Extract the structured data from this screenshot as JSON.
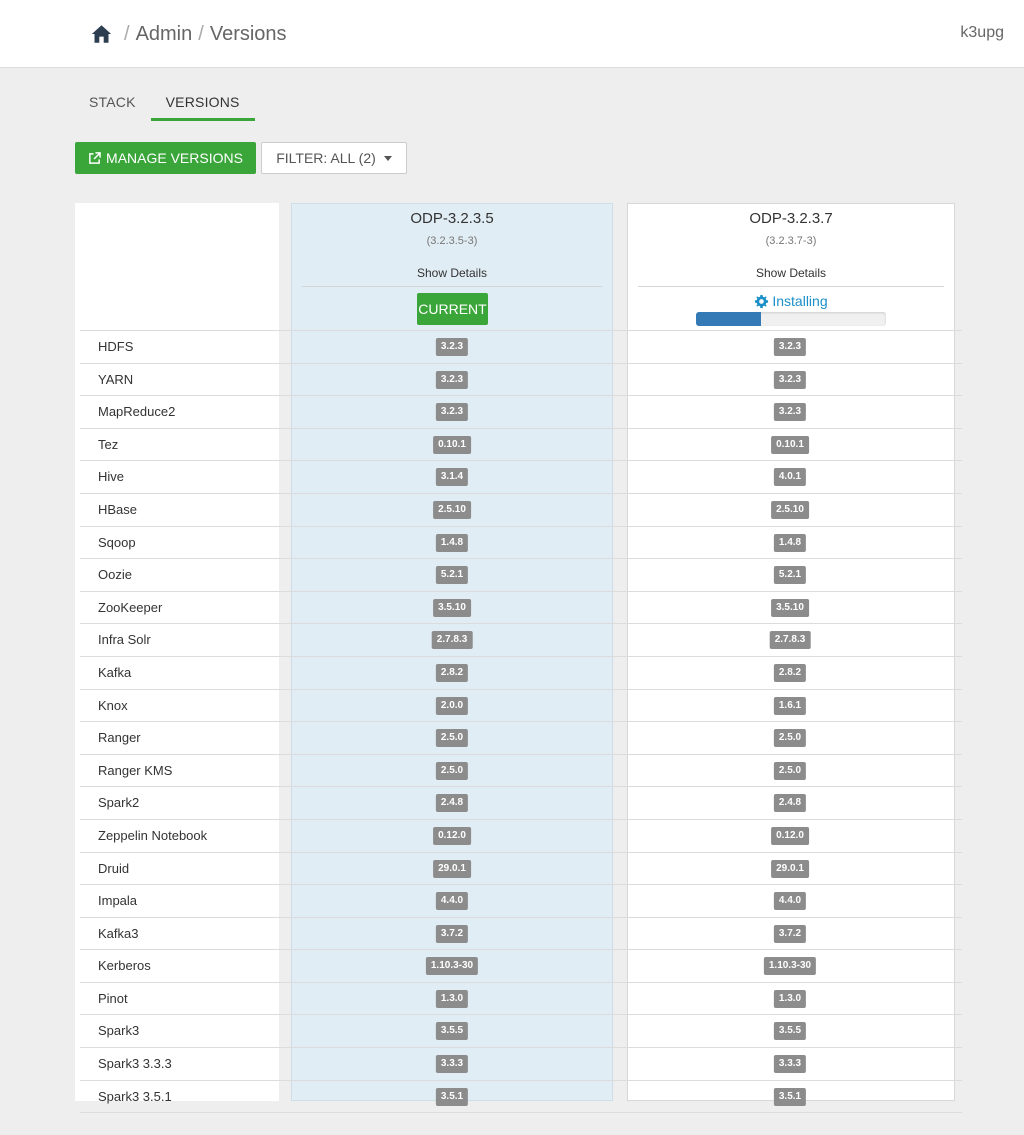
{
  "breadcrumb": {
    "items": [
      "Admin",
      "Versions"
    ],
    "separator": "/"
  },
  "user": {
    "name": "k3upg"
  },
  "tabs": [
    {
      "label": "STACK",
      "active": false
    },
    {
      "label": "VERSIONS",
      "active": true
    }
  ],
  "toolbar": {
    "manage_label": "MANAGE VERSIONS",
    "filter_label": "FILTER: ALL (2)"
  },
  "versions": [
    {
      "name": "ODP-3.2.3.5",
      "build": "(3.2.3.5-3)",
      "show_details": "Show Details",
      "status": "CURRENT"
    },
    {
      "name": "ODP-3.2.3.7",
      "build": "(3.2.3.7-3)",
      "show_details": "Show Details",
      "status": "Installing",
      "progress": 0.34
    }
  ],
  "services": [
    {
      "name": "HDFS",
      "v1": "3.2.3",
      "v2": "3.2.3"
    },
    {
      "name": "YARN",
      "v1": "3.2.3",
      "v2": "3.2.3"
    },
    {
      "name": "MapReduce2",
      "v1": "3.2.3",
      "v2": "3.2.3"
    },
    {
      "name": "Tez",
      "v1": "0.10.1",
      "v2": "0.10.1"
    },
    {
      "name": "Hive",
      "v1": "3.1.4",
      "v2": "4.0.1"
    },
    {
      "name": "HBase",
      "v1": "2.5.10",
      "v2": "2.5.10"
    },
    {
      "name": "Sqoop",
      "v1": "1.4.8",
      "v2": "1.4.8"
    },
    {
      "name": "Oozie",
      "v1": "5.2.1",
      "v2": "5.2.1"
    },
    {
      "name": "ZooKeeper",
      "v1": "3.5.10",
      "v2": "3.5.10"
    },
    {
      "name": "Infra Solr",
      "v1": "2.7.8.3",
      "v2": "2.7.8.3"
    },
    {
      "name": "Kafka",
      "v1": "2.8.2",
      "v2": "2.8.2"
    },
    {
      "name": "Knox",
      "v1": "2.0.0",
      "v2": "1.6.1"
    },
    {
      "name": "Ranger",
      "v1": "2.5.0",
      "v2": "2.5.0"
    },
    {
      "name": "Ranger KMS",
      "v1": "2.5.0",
      "v2": "2.5.0"
    },
    {
      "name": "Spark2",
      "v1": "2.4.8",
      "v2": "2.4.8"
    },
    {
      "name": "Zeppelin Notebook",
      "v1": "0.12.0",
      "v2": "0.12.0"
    },
    {
      "name": "Druid",
      "v1": "29.0.1",
      "v2": "29.0.1"
    },
    {
      "name": "Impala",
      "v1": "4.4.0",
      "v2": "4.4.0"
    },
    {
      "name": "Kafka3",
      "v1": "3.7.2",
      "v2": "3.7.2"
    },
    {
      "name": "Kerberos",
      "v1": "1.10.3-30",
      "v2": "1.10.3-30"
    },
    {
      "name": "Pinot",
      "v1": "1.3.0",
      "v2": "1.3.0"
    },
    {
      "name": "Spark3",
      "v1": "3.5.5",
      "v2": "3.5.5"
    },
    {
      "name": "Spark3 3.3.3",
      "v1": "3.3.3",
      "v2": "3.3.3"
    },
    {
      "name": "Spark3 3.5.1",
      "v1": "3.5.1",
      "v2": "3.5.1"
    }
  ],
  "colors": {
    "accent_green": "#3aa63a",
    "progress_blue": "#337ab7",
    "installing_text": "#1b8fc7",
    "version_badge": "#8c8c8c",
    "current_column_bg": "#e1edf4"
  }
}
